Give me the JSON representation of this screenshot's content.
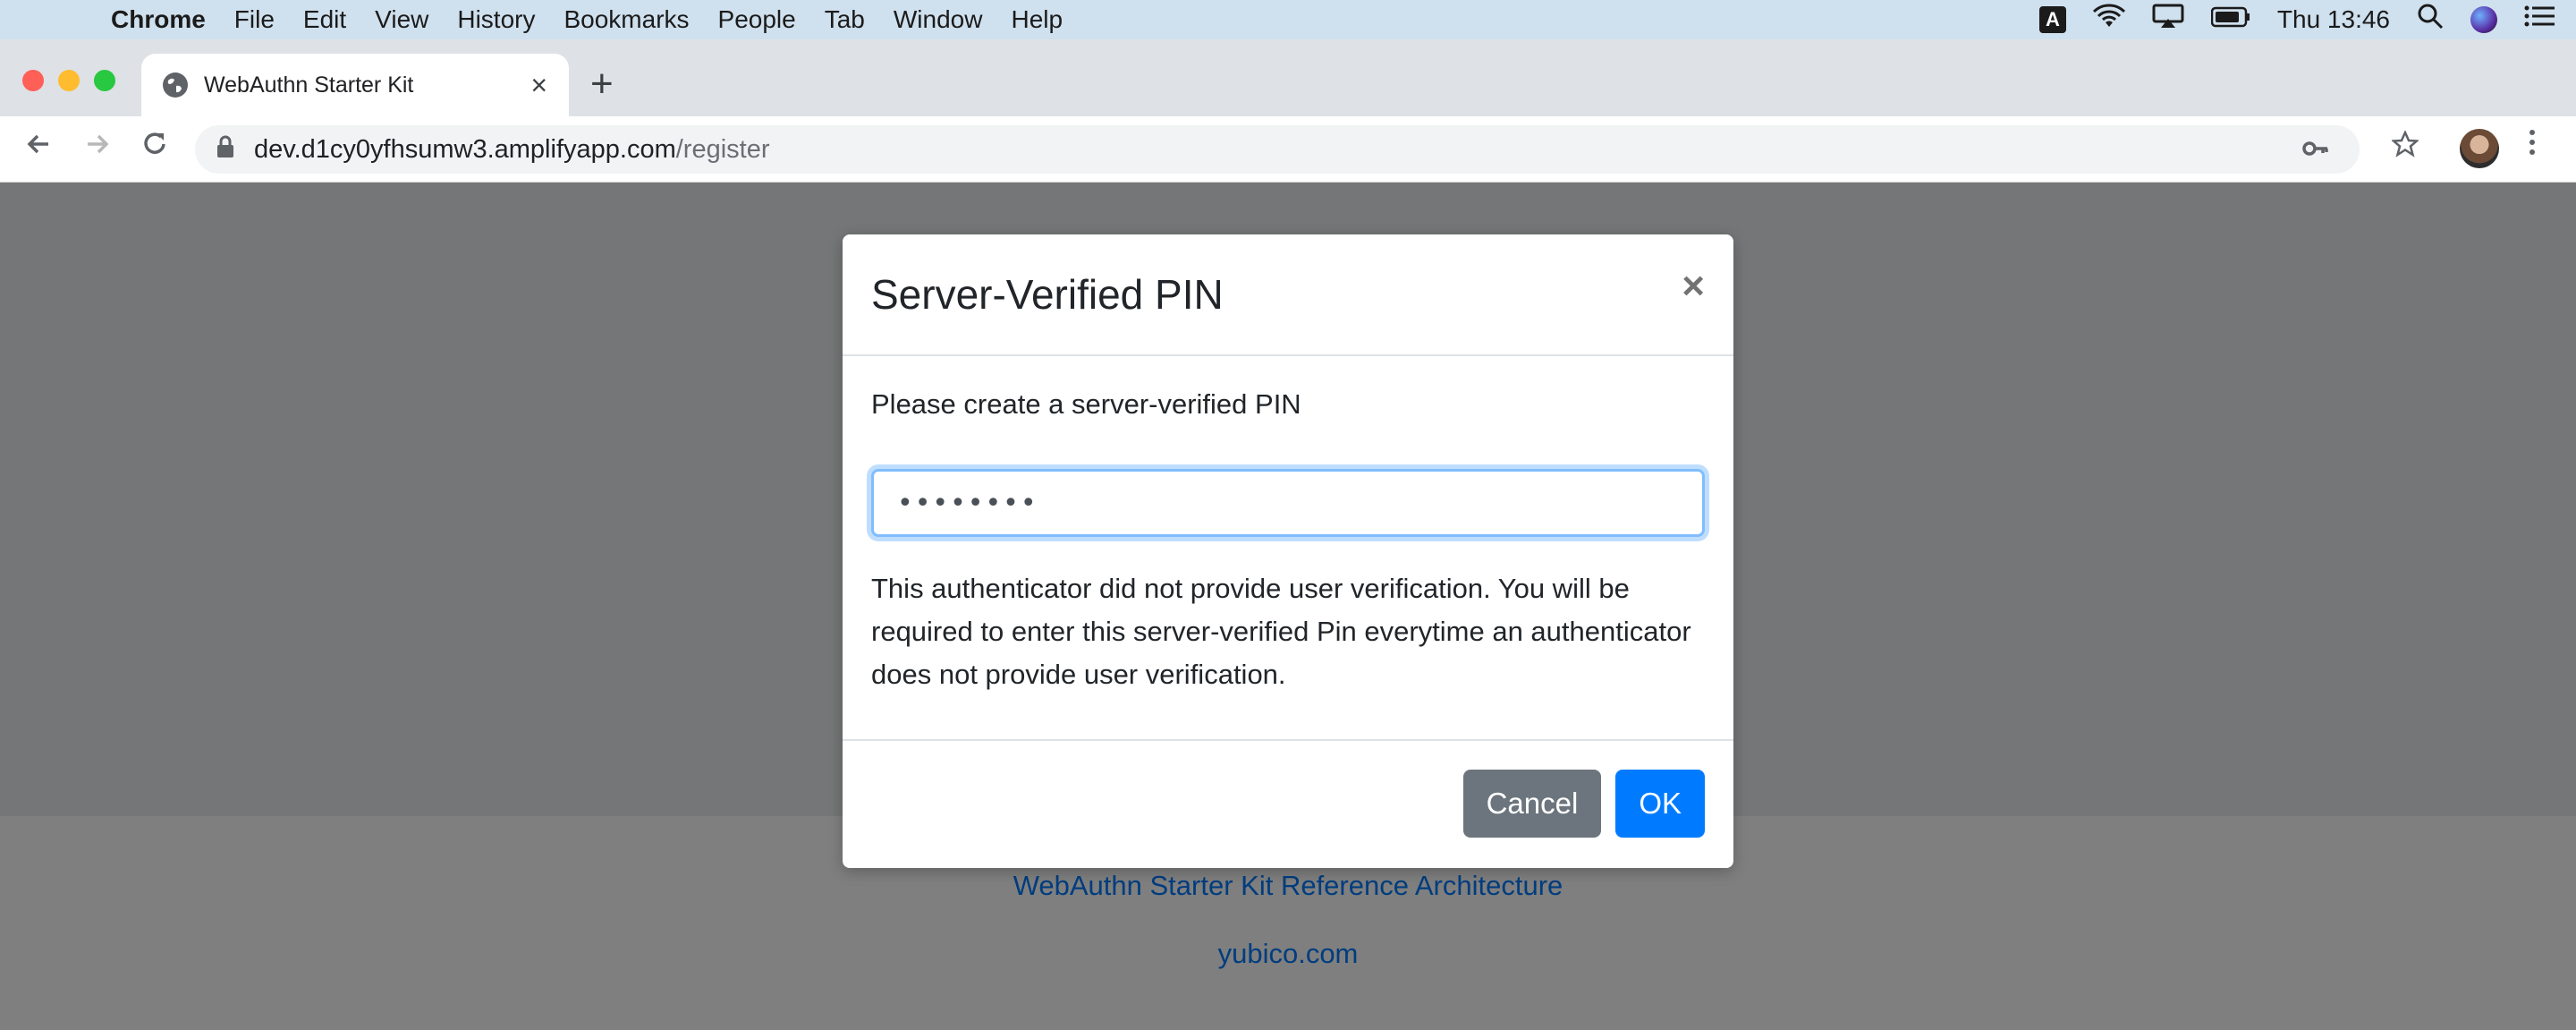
{
  "menubar": {
    "apple_icon": "apple-logo-icon",
    "app_name": "Chrome",
    "items": [
      "File",
      "Edit",
      "View",
      "History",
      "Bookmarks",
      "People",
      "Tab",
      "Window",
      "Help"
    ],
    "status": {
      "input_badge": "A",
      "clock": "Thu 13:46"
    }
  },
  "browser": {
    "tab_title": "WebAuthn Starter Kit",
    "url_host": "dev.d1cy0yfhsumw3.amplifyapp.com",
    "url_path": "/register"
  },
  "modal": {
    "title": "Server-Verified PIN",
    "close_glyph": "×",
    "prompt": "Please create a server-verified PIN",
    "pin_value": "••••••••",
    "note": "This authenticator did not provide user verification. You will be required to enter this server-verified Pin everytime an authenticator does not provide user verification.",
    "cancel_label": "Cancel",
    "ok_label": "OK"
  },
  "page": {
    "footer_links": [
      "WebAuthn Starter Kit Reference Architecture",
      "yubico.com"
    ]
  },
  "colors": {
    "primary": "#007bff",
    "secondary": "#6c757d",
    "link": "#007bff"
  }
}
